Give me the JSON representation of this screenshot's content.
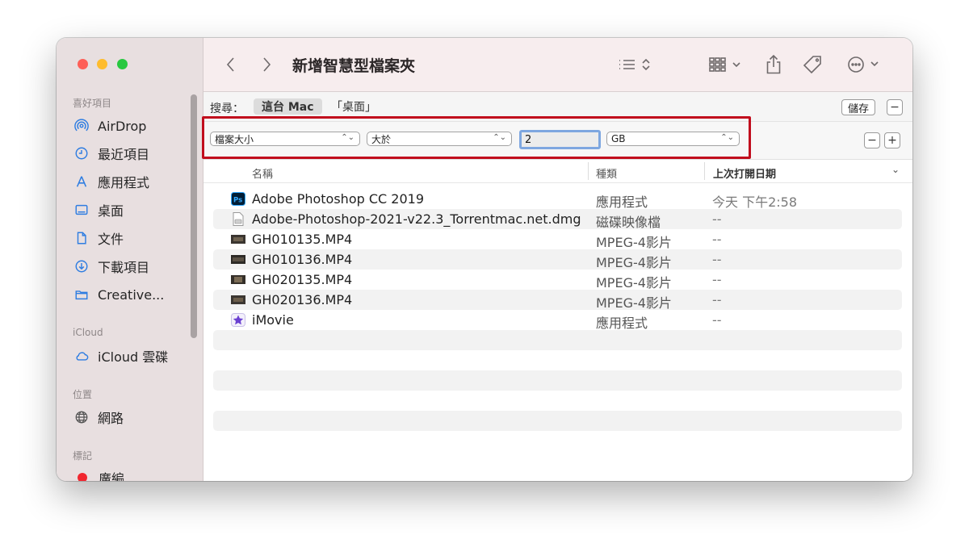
{
  "window": {
    "title": "新增智慧型檔案夾"
  },
  "sidebar": {
    "sections": [
      {
        "label": "喜好項目"
      },
      {
        "label": "iCloud"
      },
      {
        "label": "位置"
      },
      {
        "label": "標記"
      }
    ],
    "favorites": [
      {
        "label": "AirDrop",
        "icon": "airdrop-icon"
      },
      {
        "label": "最近項目",
        "icon": "clock-icon"
      },
      {
        "label": "應用程式",
        "icon": "applications-icon"
      },
      {
        "label": "桌面",
        "icon": "desktop-icon"
      },
      {
        "label": "文件",
        "icon": "document-icon"
      },
      {
        "label": "下載項目",
        "icon": "download-icon"
      },
      {
        "label": "Creative...",
        "icon": "folder-icon"
      }
    ],
    "icloud": [
      {
        "label": "iCloud 雲碟",
        "icon": "cloud-icon"
      }
    ],
    "locations": [
      {
        "label": "網路",
        "icon": "network-icon"
      }
    ],
    "tags": [
      {
        "label": "廣編",
        "color": "#f1262f"
      }
    ]
  },
  "toolbar": {
    "back_icon": "chevron-left-icon",
    "forward_icon": "chevron-right-icon",
    "list_view_icon": "list-view-icon",
    "group_icon": "grid-view-icon",
    "share_icon": "share-icon",
    "tag_icon": "tag-icon",
    "more_icon": "ellipsis-circle-icon",
    "search_icon": "search-icon"
  },
  "search": {
    "label": "搜尋：",
    "scopes": [
      {
        "label": "這台 Mac",
        "active": true
      },
      {
        "label": "「桌面」",
        "active": false
      }
    ],
    "save_label": "儲存",
    "remove_label": "−"
  },
  "criteria": {
    "attribute": "檔案大小",
    "operator": "大於",
    "value": "2",
    "unit": "GB",
    "remove_label": "−",
    "add_label": "+"
  },
  "columns": {
    "name": "名稱",
    "kind": "種類",
    "date": "上次打開日期"
  },
  "files": [
    {
      "name": "Adobe Photoshop CC 2019",
      "kind": "應用程式",
      "date": "今天 下午2:58",
      "icon": "photoshop-icon"
    },
    {
      "name": "Adobe-Photoshop-2021-v22.3_Torrentmac.net.dmg",
      "kind": "磁碟映像檔",
      "date": "--",
      "icon": "disk-image-icon"
    },
    {
      "name": "GH010135.MP4",
      "kind": "MPEG-4影片",
      "date": "--",
      "icon": "video-thumbnail-icon"
    },
    {
      "name": "GH010136.MP4",
      "kind": "MPEG-4影片",
      "date": "--",
      "icon": "video-thumbnail-icon"
    },
    {
      "name": "GH020135.MP4",
      "kind": "MPEG-4影片",
      "date": "--",
      "icon": "video-thumbnail-icon"
    },
    {
      "name": "GH020136.MP4",
      "kind": "MPEG-4影片",
      "date": "--",
      "icon": "video-thumbnail-icon"
    },
    {
      "name": "iMovie",
      "kind": "應用程式",
      "date": "--",
      "icon": "imovie-icon"
    }
  ],
  "colors": {
    "highlight": "#c10d1d",
    "traffic_red": "#fe5f57",
    "traffic_yellow": "#febc2e",
    "traffic_green": "#28c840"
  }
}
